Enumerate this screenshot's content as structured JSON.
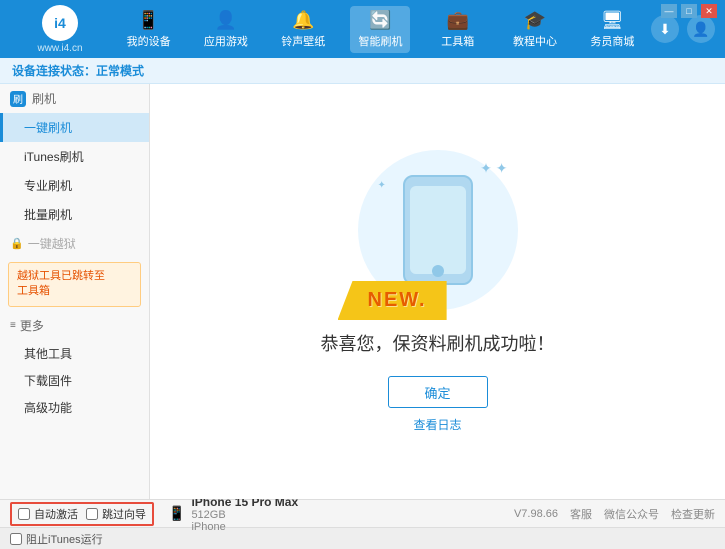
{
  "app": {
    "logo_text": "i4",
    "logo_sub": "www.i4.cn"
  },
  "nav": {
    "items": [
      {
        "id": "my-device",
        "icon": "📱",
        "label": "我的设备"
      },
      {
        "id": "apps-games",
        "icon": "👤",
        "label": "应用游戏"
      },
      {
        "id": "ringtones",
        "icon": "🔔",
        "label": "铃声壁纸"
      },
      {
        "id": "smart-flash",
        "icon": "🔄",
        "label": "智能刷机",
        "active": true
      },
      {
        "id": "toolbox",
        "icon": "💼",
        "label": "工具箱"
      },
      {
        "id": "tutorial",
        "icon": "🎓",
        "label": "教程中心"
      },
      {
        "id": "service",
        "icon": "🖥",
        "label": "务员商城"
      }
    ]
  },
  "status": {
    "prefix": "设备连接状态：",
    "mode": "正常模式"
  },
  "sidebar": {
    "section1_icon": "刷",
    "section1_label": "刷机",
    "items": [
      {
        "id": "one-click-flash",
        "label": "一键刷机",
        "active": true
      },
      {
        "id": "itunes-flash",
        "label": "iTunes刷机"
      },
      {
        "id": "pro-flash",
        "label": "专业刷机"
      },
      {
        "id": "batch-flash",
        "label": "批量刷机"
      }
    ],
    "disabled_label": "一键越狱",
    "notice": "越狱工具已跳转至\n工具箱",
    "more_label": "更多",
    "more_items": [
      {
        "id": "other-tools",
        "label": "其他工具"
      },
      {
        "id": "download-firmware",
        "label": "下载固件"
      },
      {
        "id": "advanced",
        "label": "高级功能"
      }
    ]
  },
  "content": {
    "new_badge": "NEW.",
    "success_text": "恭喜您，保资料刷机成功啦！",
    "confirm_button": "确定",
    "log_link": "查看日志"
  },
  "bottom": {
    "auto_activate_label": "自动激活",
    "guide_label": "跳过向导",
    "device_name": "iPhone 15 Pro Max",
    "device_storage": "512GB",
    "device_type": "iPhone",
    "version": "V7.98.66",
    "client_label": "客服",
    "wechat_label": "微信公众号",
    "check_update_label": "检查更新"
  },
  "itunes": {
    "label": "阻止iTunes运行"
  },
  "window_controls": {
    "minimize": "—",
    "maximize": "□",
    "close": "✕"
  }
}
